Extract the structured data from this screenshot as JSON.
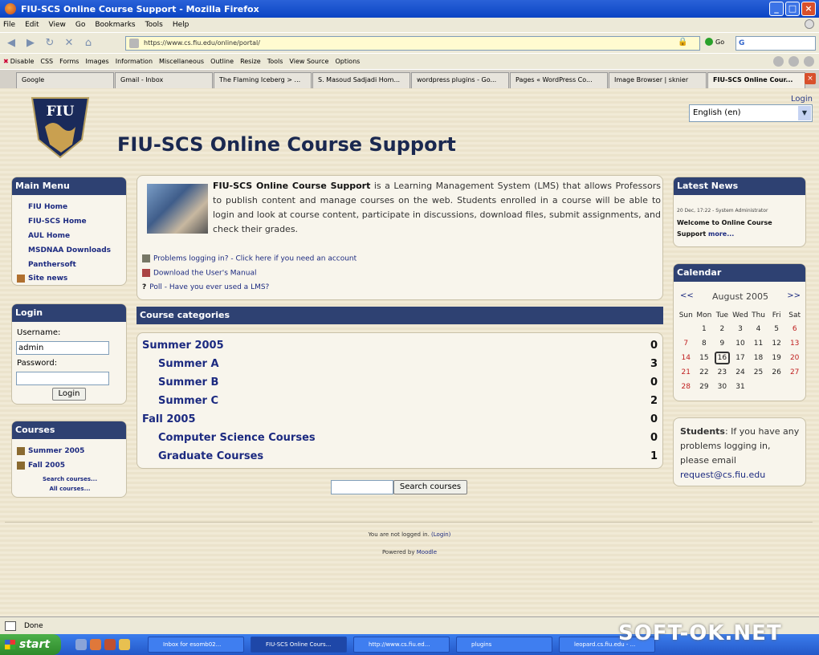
{
  "window": {
    "title": "FIU-SCS Online Course Support - Mozilla Firefox"
  },
  "menubar": [
    "File",
    "Edit",
    "View",
    "Go",
    "Bookmarks",
    "Tools",
    "Help"
  ],
  "navbar": {
    "url": "https://www.cs.fiu.edu/online/portal/",
    "go_label": "Go",
    "search_letter": "G"
  },
  "devbar": [
    "Disable",
    "CSS",
    "Forms",
    "Images",
    "Information",
    "Miscellaneous",
    "Outline",
    "Resize",
    "Tools",
    "View Source",
    "Options"
  ],
  "tabs": [
    {
      "label": "Google",
      "active": false
    },
    {
      "label": "Gmail - Inbox",
      "active": false
    },
    {
      "label": "The Flaming Iceberg > ...",
      "active": false
    },
    {
      "label": "S. Masoud Sadjadi Hom...",
      "active": false
    },
    {
      "label": "wordpress plugins - Go...",
      "active": false
    },
    {
      "label": "Pages « WordPress Co...",
      "active": false
    },
    {
      "label": "Image Browser | sknier",
      "active": false
    },
    {
      "label": "FIU-SCS Online Cour...",
      "active": true
    }
  ],
  "header": {
    "logo_text": "FIU",
    "site_title": "FIU-SCS Online Course Support",
    "login_link": "Login",
    "language": "English (en)"
  },
  "main_menu": {
    "title": "Main Menu",
    "items": [
      "FIU Home",
      "FIU-SCS Home",
      "AUL Home",
      "MSDNAA Downloads",
      "Panthersoft",
      "Site news"
    ]
  },
  "login": {
    "title": "Login",
    "username_label": "Username:",
    "username_value": "admin",
    "password_label": "Password:",
    "button": "Login"
  },
  "courses": {
    "title": "Courses",
    "items": [
      "Summer 2005",
      "Fall 2005"
    ],
    "search_link": "Search courses...",
    "all_link": "All courses..."
  },
  "intro": {
    "bold": "FIU-SCS Online Course Support",
    "text": " is a Learning Management System (LMS) that allows Professors to publish content and manage courses on the web. Students enrolled in a course will be able to login and look at course content, participate in discussions, download files, submit assignments, and check their grades.",
    "links": [
      "Problems logging in? - Click here if you need an account",
      "Download the User's Manual",
      "Poll - Have you ever used a LMS?"
    ]
  },
  "categories": {
    "title": "Course categories",
    "rows": [
      {
        "name": "Summer 2005",
        "count": "0",
        "level": 0
      },
      {
        "name": "Summer A",
        "count": "3",
        "level": 1
      },
      {
        "name": "Summer B",
        "count": "0",
        "level": 1
      },
      {
        "name": "Summer C",
        "count": "2",
        "level": 1
      },
      {
        "name": "Fall 2005",
        "count": "0",
        "level": 0
      },
      {
        "name": "Computer Science Courses",
        "count": "0",
        "level": 1
      },
      {
        "name": "Graduate Courses",
        "count": "1",
        "level": 1
      }
    ]
  },
  "search_button": "Search courses",
  "news": {
    "title": "Latest News",
    "meta": "20 Dec, 17:22 - System Administrator",
    "headline": "Welcome to Online Course Support",
    "more": "more..."
  },
  "calendar": {
    "title": "Calendar",
    "month": "August 2005",
    "prev": "<<",
    "next": ">>",
    "days": [
      "Sun",
      "Mon",
      "Tue",
      "Wed",
      "Thu",
      "Fri",
      "Sat"
    ],
    "weeks": [
      [
        "",
        "1",
        "2",
        "3",
        "4",
        "5",
        "6"
      ],
      [
        "7",
        "8",
        "9",
        "10",
        "11",
        "12",
        "13"
      ],
      [
        "14",
        "15",
        "16",
        "17",
        "18",
        "19",
        "20"
      ],
      [
        "21",
        "22",
        "23",
        "24",
        "25",
        "26",
        "27"
      ],
      [
        "28",
        "29",
        "30",
        "31",
        "",
        "",
        ""
      ]
    ],
    "today": "16"
  },
  "students": {
    "bold": "Students",
    "text": ": If you have any problems logging in, please email",
    "email": "request@cs.fiu.edu"
  },
  "footer": {
    "not_logged": "You are not logged in.",
    "login": "(Login)",
    "powered": "Powered by",
    "moodle": "Moodle"
  },
  "status": "Done",
  "taskbar": {
    "start": "start",
    "tasks": [
      {
        "label": "Inbox for esomb02...",
        "active": false
      },
      {
        "label": "FIU-SCS Online Cours...",
        "active": true
      },
      {
        "label": "http://www.cs.fiu.ed...",
        "active": false
      },
      {
        "label": "plugins",
        "active": false
      },
      {
        "label": "leopard.cs.fiu.edu - ...",
        "active": false
      }
    ]
  },
  "watermark": "SOFT-OK.NET",
  "colors": {
    "block_header": "#2e4172",
    "link": "#1c2a80",
    "page_bg": "#f1ead6"
  }
}
